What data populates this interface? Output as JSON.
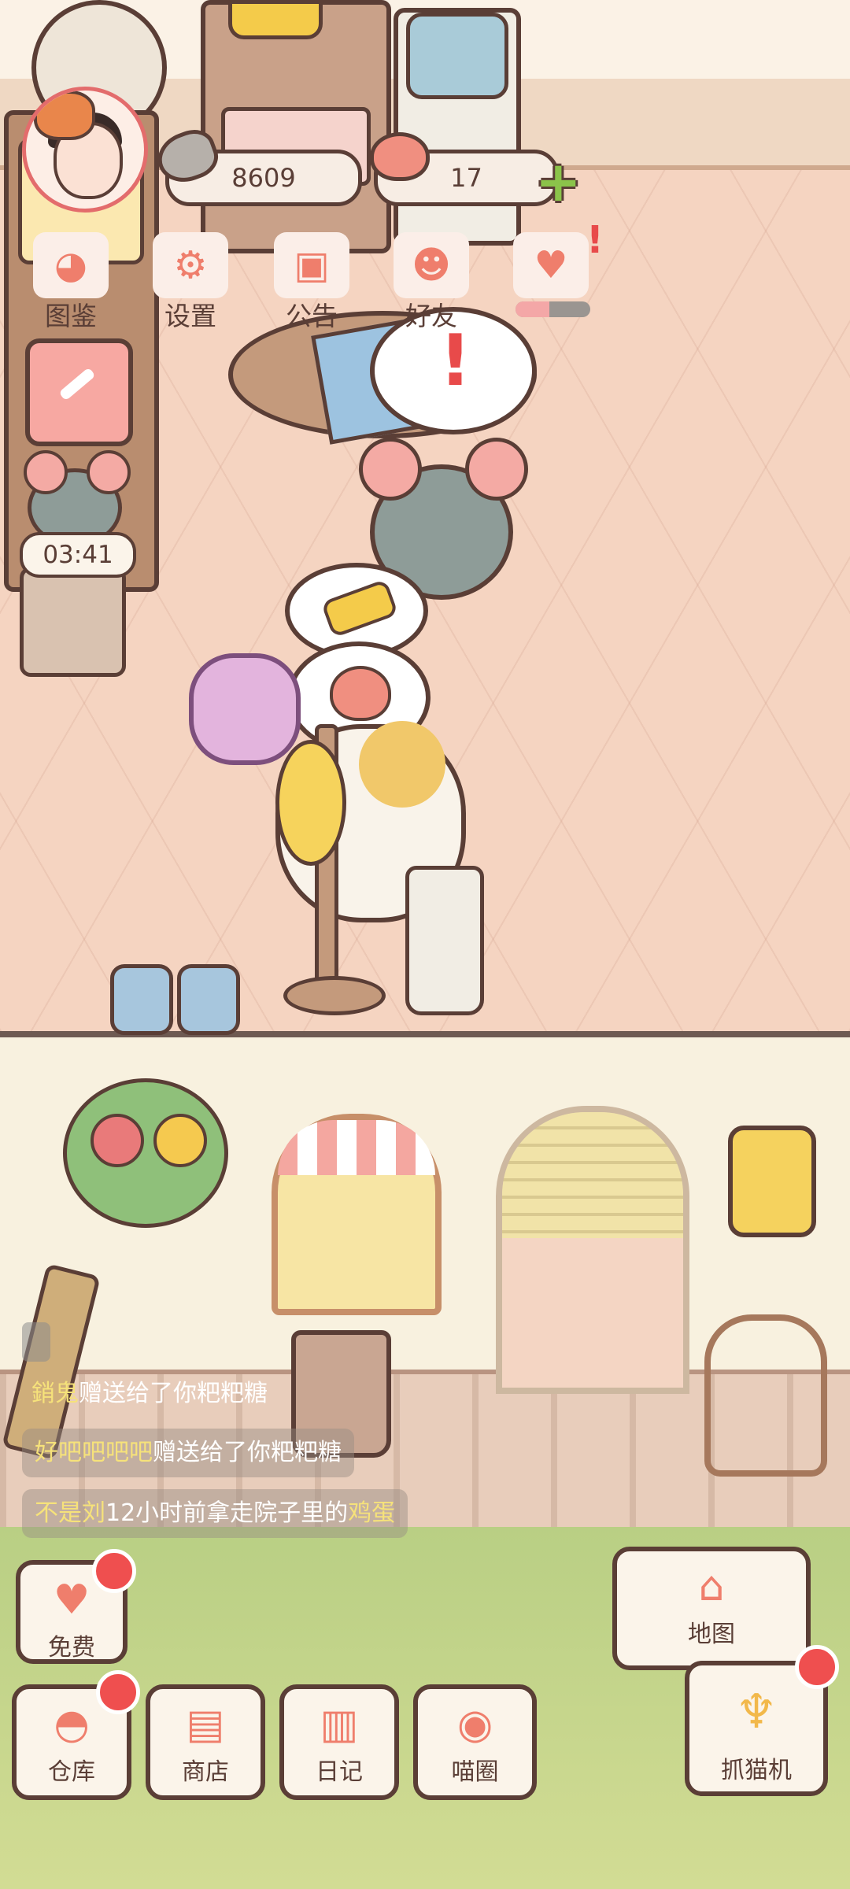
{
  "hud": {
    "fish_count": "8609",
    "heart_count": "17",
    "plus_symbol": "+",
    "menu": [
      {
        "label": "图鉴",
        "icon": "cat-face-icon"
      },
      {
        "label": "设置",
        "icon": "gear-icon"
      },
      {
        "label": "公告",
        "icon": "gift-icon"
      },
      {
        "label": "好友",
        "icon": "friends-icon"
      },
      {
        "label": "",
        "icon": "broken-heart-icon"
      }
    ],
    "love_progress_percent": 45,
    "exclaim_mark": "!",
    "timer": "03:41"
  },
  "feed": [
    {
      "name": "銷鬼",
      "text": "赠送给了你粑粑糖"
    },
    {
      "name": "好吧吧吧吧",
      "text": "赠送给了你粑粑糖"
    },
    {
      "prefix": "不是",
      "name": "刘",
      "middle": "12小时前拿走院子里的",
      "item": "鸡蛋"
    }
  ],
  "bottom": {
    "free": "免费",
    "warehouse": "仓库",
    "shop": "商店",
    "diary": "日记",
    "circle": "喵圈",
    "map": "地图",
    "claw": "抓猫机"
  },
  "colors": {
    "accent": "#ef7e6c",
    "badge": "#ef4f4f",
    "outline": "#5a3e36",
    "plus": "#8bc34a"
  }
}
